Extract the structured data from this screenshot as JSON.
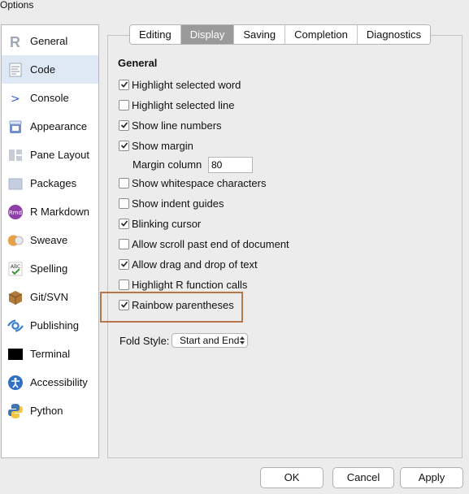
{
  "window": {
    "title": "Options"
  },
  "sidebar": {
    "items": [
      {
        "label": "General",
        "icon": "r-logo-icon"
      },
      {
        "label": "Code",
        "icon": "code-doc-icon",
        "active": true
      },
      {
        "label": "Console",
        "icon": "console-prompt-icon"
      },
      {
        "label": "Appearance",
        "icon": "paint-bucket-icon"
      },
      {
        "label": "Pane Layout",
        "icon": "pane-layout-icon"
      },
      {
        "label": "Packages",
        "icon": "packages-icon"
      },
      {
        "label": "R Markdown",
        "icon": "rmd-icon",
        "badge": "Rmd"
      },
      {
        "label": "Sweave",
        "icon": "sweave-icon"
      },
      {
        "label": "Spelling",
        "icon": "spelling-icon",
        "badge": "ABC"
      },
      {
        "label": "Git/SVN",
        "icon": "git-box-icon"
      },
      {
        "label": "Publishing",
        "icon": "publishing-icon"
      },
      {
        "label": "Terminal",
        "icon": "terminal-icon"
      },
      {
        "label": "Accessibility",
        "icon": "accessibility-icon"
      },
      {
        "label": "Python",
        "icon": "python-icon"
      }
    ]
  },
  "tabs": [
    {
      "label": "Editing"
    },
    {
      "label": "Display",
      "active": true
    },
    {
      "label": "Saving"
    },
    {
      "label": "Completion"
    },
    {
      "label": "Diagnostics"
    }
  ],
  "panel": {
    "section_title": "General",
    "options": [
      {
        "label": "Highlight selected word",
        "checked": true
      },
      {
        "label": "Highlight selected line",
        "checked": false
      },
      {
        "label": "Show line numbers",
        "checked": true
      },
      {
        "label": "Show margin",
        "checked": true
      },
      {
        "label": "Show whitespace characters",
        "checked": false
      },
      {
        "label": "Show indent guides",
        "checked": false
      },
      {
        "label": "Blinking cursor",
        "checked": true
      },
      {
        "label": "Allow scroll past end of document",
        "checked": false
      },
      {
        "label": "Allow drag and drop of text",
        "checked": true
      },
      {
        "label": "Highlight R function calls",
        "checked": false
      },
      {
        "label": "Rainbow parentheses",
        "checked": true
      }
    ],
    "margin_column": {
      "label": "Margin column",
      "value": "80"
    },
    "fold_style": {
      "label": "Fold Style:",
      "value": "Start and End"
    }
  },
  "buttons": {
    "ok": "OK",
    "cancel": "Cancel",
    "apply": "Apply"
  },
  "colors": {
    "highlight_border": "#b8774a",
    "active_tab": "#9a9a9a",
    "active_sidebar": "#dfe9f5"
  }
}
